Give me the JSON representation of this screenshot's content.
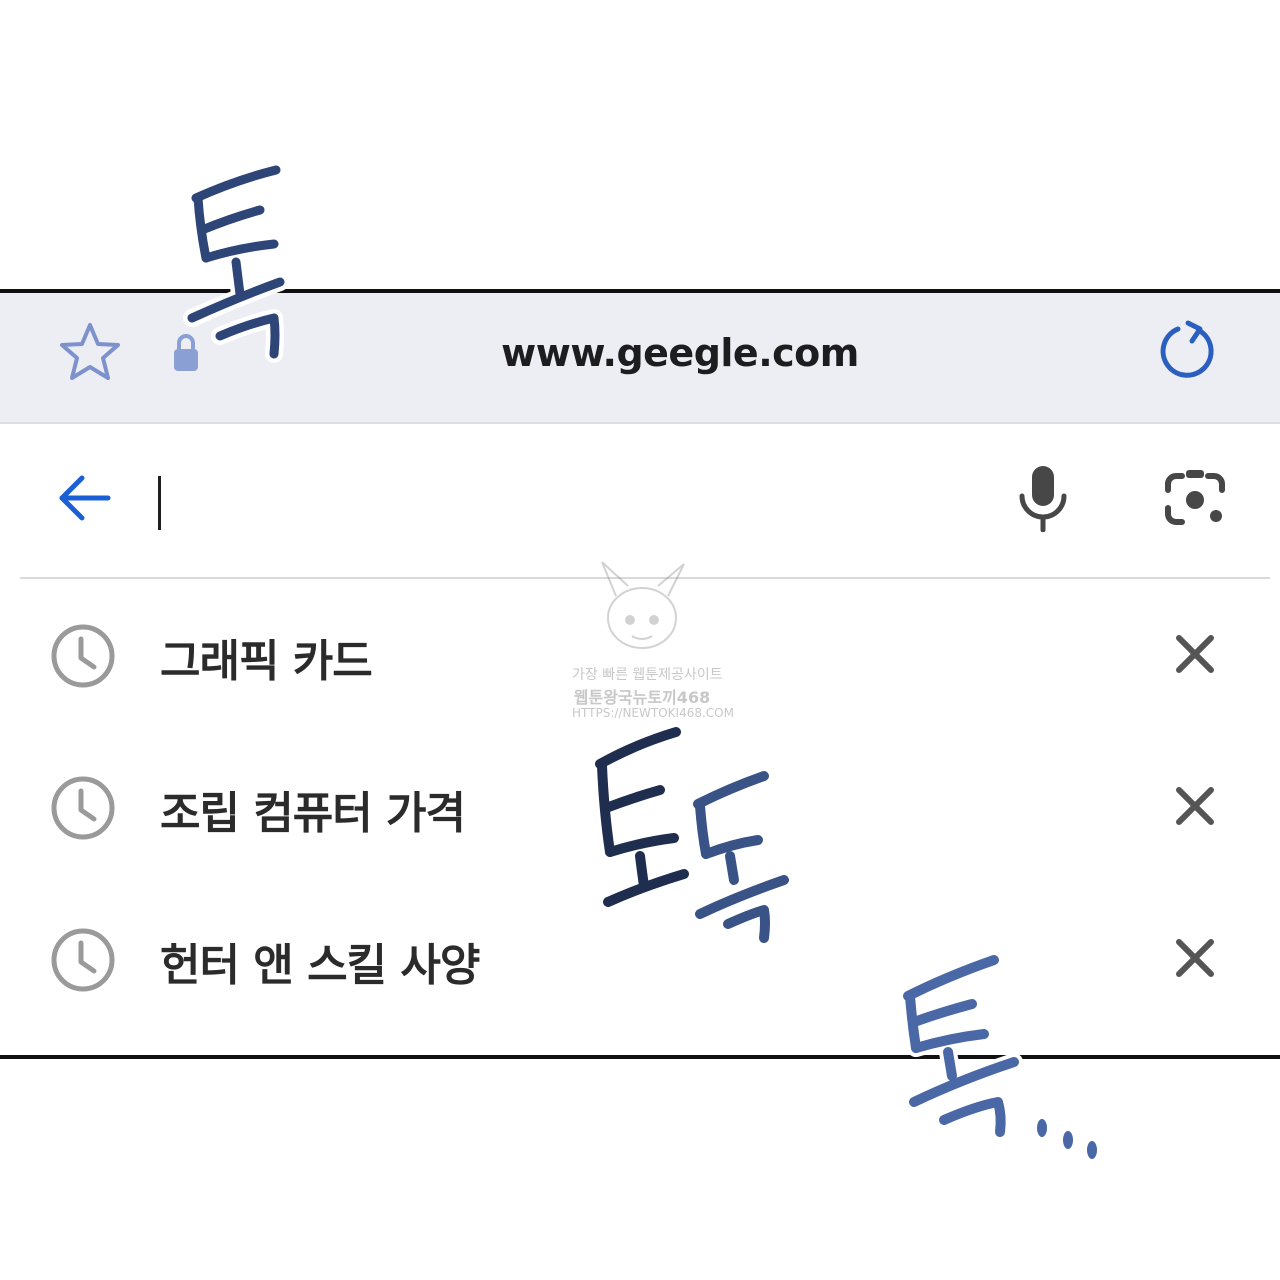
{
  "browser": {
    "url": "www.geegle.com",
    "accent_color": "#1a5fd6",
    "icons": {
      "bookmark": "star-icon",
      "security": "lock-icon",
      "reload": "reload-icon"
    }
  },
  "search": {
    "value": "",
    "icons": {
      "back": "arrow-left-icon",
      "voice": "microphone-icon",
      "image_search": "camera-lens-icon"
    }
  },
  "suggestions": [
    {
      "label": "그래픽 카드",
      "icon": "clock-icon",
      "action": "close-icon"
    },
    {
      "label": "조립 컴퓨터 가격",
      "icon": "clock-icon",
      "action": "close-icon"
    },
    {
      "label": "헌터 앤 스킬 사양",
      "icon": "clock-icon",
      "action": "close-icon"
    }
  ],
  "watermark": {
    "line1": "가장 빠른 웹툰제공사이트",
    "line2": "웹툰왕국뉴토끼468",
    "line3": "HTTPS://NEWTOKI468.COM"
  },
  "sound_effects": {
    "tap1": "톡",
    "tap2": "토독",
    "tap3": "톡...",
    "color": "#3a5387"
  }
}
